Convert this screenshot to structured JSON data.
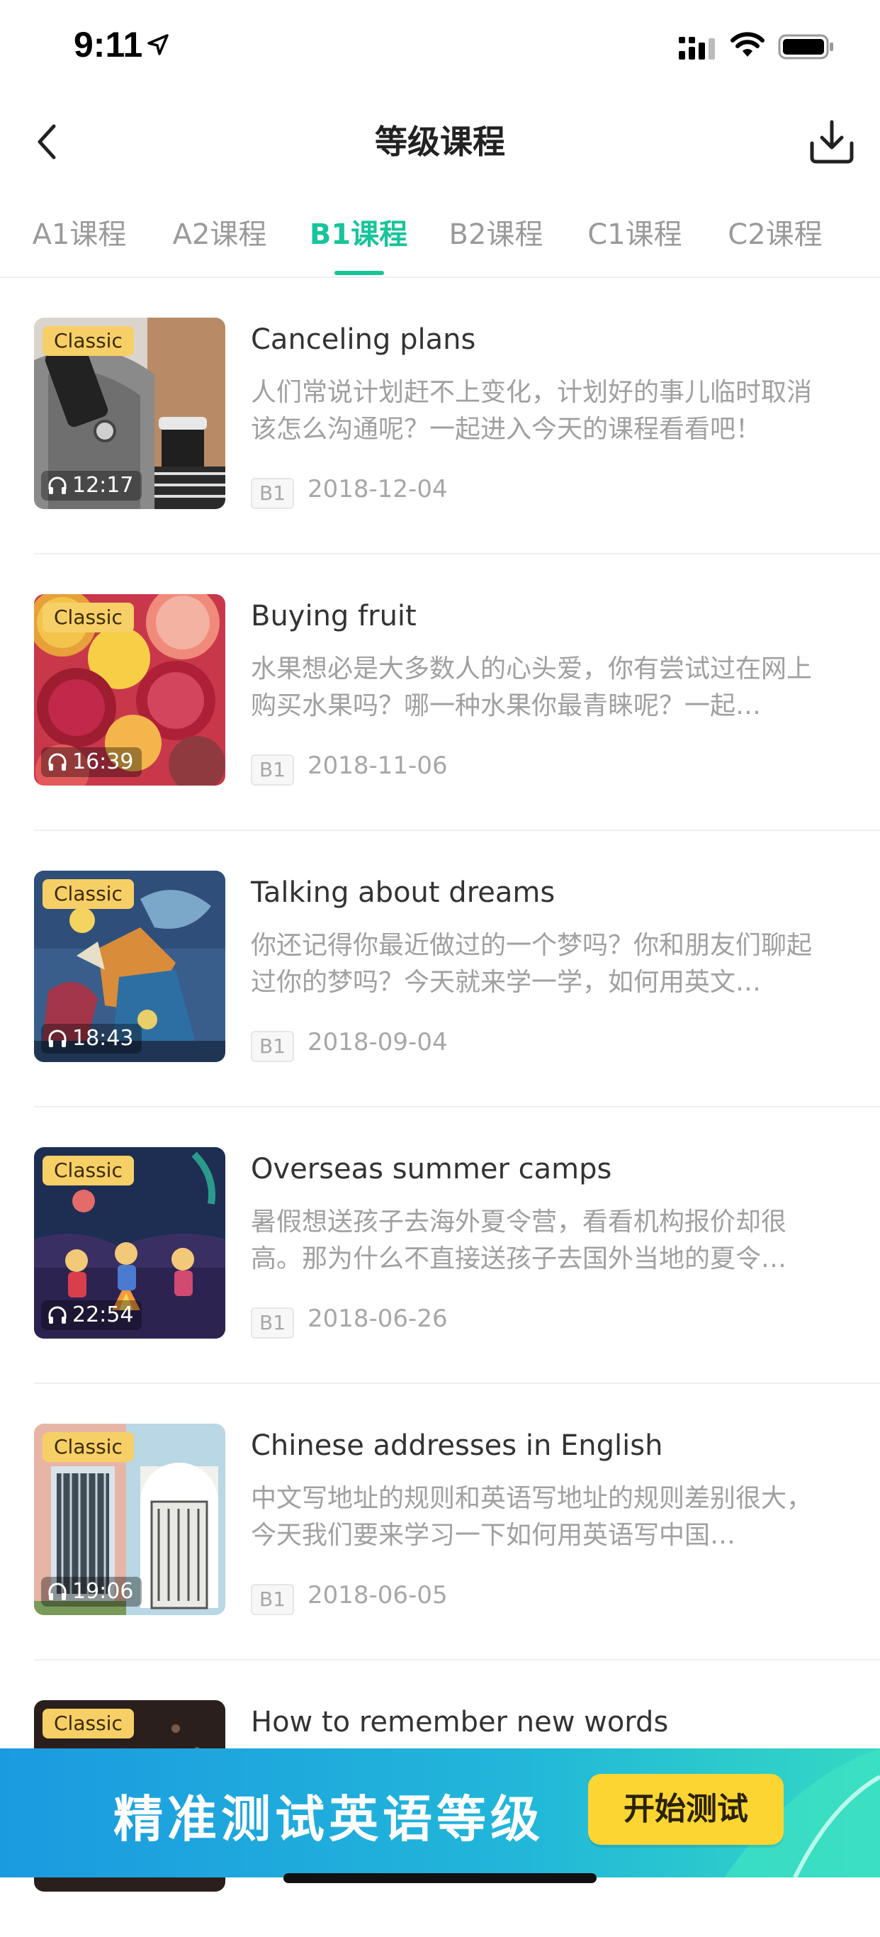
{
  "status": {
    "time": "9:11"
  },
  "nav": {
    "title": "等级课程"
  },
  "tabs": [
    {
      "label": "A1课程",
      "active": false
    },
    {
      "label": "A2课程",
      "active": false
    },
    {
      "label": "B1课程",
      "active": true
    },
    {
      "label": "B2课程",
      "active": false
    },
    {
      "label": "C1课程",
      "active": false
    },
    {
      "label": "C2课程",
      "active": false
    }
  ],
  "courses": [
    {
      "badge": "Classic",
      "duration": "12:17",
      "title": "Canceling plans",
      "desc": "人们常说计划赶不上变化，计划好的事儿临时取消该怎么沟通呢？一起进入今天的课程看看吧！",
      "level": "B1",
      "date": "2018-12-04"
    },
    {
      "badge": "Classic",
      "duration": "16:39",
      "title": "Buying fruit",
      "desc": "水果想必是大多数人的心头爱，你有尝试过在网上购买水果吗？哪一种水果你最青睐呢？一起…",
      "level": "B1",
      "date": "2018-11-06"
    },
    {
      "badge": "Classic",
      "duration": "18:43",
      "title": "Talking about dreams",
      "desc": "你还记得你最近做过的一个梦吗？你和朋友们聊起过你的梦吗？今天就来学一学，如何用英文…",
      "level": "B1",
      "date": "2018-09-04"
    },
    {
      "badge": "Classic",
      "duration": "22:54",
      "title": "Overseas summer camps",
      "desc": "暑假想送孩子去海外夏令营，看看机构报价却很高。那为什么不直接送孩子去国外当地的夏令…",
      "level": "B1",
      "date": "2018-06-26"
    },
    {
      "badge": "Classic",
      "duration": "19:06",
      "title": "Chinese addresses in English",
      "desc": "中文写地址的规则和英语写地址的规则差别很大，今天我们要来学习一下如何用英语写中国…",
      "level": "B1",
      "date": "2018-06-05"
    },
    {
      "badge": "Classic",
      "duration": "",
      "title": "How to remember new words",
      "desc": "",
      "level": "",
      "date": ""
    }
  ],
  "banner": {
    "text": "精准测试英语等级",
    "button": "开始测试"
  },
  "colors": {
    "accent": "#18c49a",
    "badge": "#f7cf67",
    "banner_button": "#fcd533"
  },
  "icons": {
    "back": "chevron-left-icon",
    "download": "download-icon",
    "headphones": "headphones-icon"
  }
}
